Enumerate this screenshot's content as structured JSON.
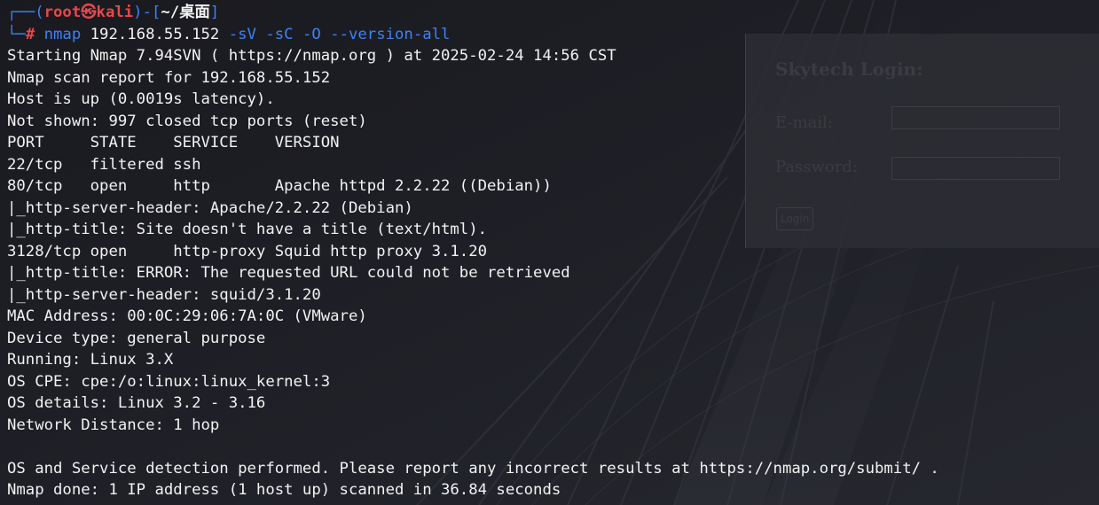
{
  "prompt": {
    "corner_top": "┌──(",
    "user": "root",
    "at_symbol": "㉿",
    "host": "kali",
    "mid": ")-[",
    "path": "~/桌面",
    "close": "]",
    "corner_bottom": "└─",
    "hash": "#",
    "command": "nmap",
    "target": "192.168.55.152",
    "flags": "-sV -sC -O --version-all"
  },
  "output_lines": [
    "Starting Nmap 7.94SVN ( https://nmap.org ) at 2025-02-24 14:56 CST",
    "Nmap scan report for 192.168.55.152",
    "Host is up (0.0019s latency).",
    "Not shown: 997 closed tcp ports (reset)",
    "PORT     STATE    SERVICE    VERSION",
    "22/tcp   filtered ssh",
    "80/tcp   open     http       Apache httpd 2.2.22 ((Debian))",
    "|_http-server-header: Apache/2.2.22 (Debian)",
    "|_http-title: Site doesn't have a title (text/html).",
    "3128/tcp open     http-proxy Squid http proxy 3.1.20",
    "|_http-title: ERROR: The requested URL could not be retrieved",
    "|_http-server-header: squid/3.1.20",
    "MAC Address: 00:0C:29:06:7A:0C (VMware)",
    "Device type: general purpose",
    "Running: Linux 3.X",
    "OS CPE: cpe:/o:linux:linux_kernel:3",
    "OS details: Linux 3.2 - 3.16",
    "Network Distance: 1 hop",
    "",
    "OS and Service detection performed. Please report any incorrect results at https://nmap.org/submit/ .",
    "Nmap done: 1 IP address (1 host up) scanned in 36.84 seconds"
  ],
  "login_panel": {
    "title": "Skytech Login:",
    "email_label": "E-mail:",
    "password_label": "Password:",
    "email_value": "",
    "password_value": "",
    "button_label": "Login"
  },
  "colors": {
    "prompt_red": "#e5484d",
    "command_blue": "#3b82f6",
    "terminal_text": "#f2f2f2",
    "background": "#1d1e24"
  }
}
